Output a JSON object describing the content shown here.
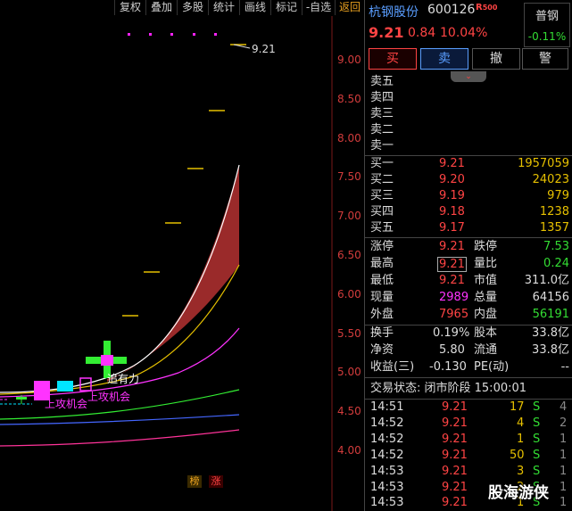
{
  "toolbar": {
    "items": [
      "复权",
      "叠加",
      "多股",
      "统计",
      "画线",
      "标记",
      "-自选",
      "返回"
    ]
  },
  "chart": {
    "y_ticks": [
      "9.00",
      "8.50",
      "8.00",
      "7.50",
      "7.00",
      "6.50",
      "6.00",
      "5.50",
      "5.00",
      "4.50",
      "4.00"
    ],
    "peak_label": "9.21",
    "annotations": [
      "上攻机会",
      "上攻机会",
      "追有力"
    ],
    "bottom_tags": [
      "榜",
      "涨"
    ]
  },
  "stock": {
    "name": "杭钢股份",
    "code": "600126",
    "r_tag": "R",
    "r_num": "500",
    "price": "9.21",
    "change": "0.84",
    "change_pct": "10.04%",
    "index_name": "普钢",
    "index_pct": "-0.11%"
  },
  "actions": [
    "买",
    "卖",
    "撤",
    "警"
  ],
  "asks": [
    {
      "label": "卖五",
      "price": "",
      "vol": ""
    },
    {
      "label": "卖四",
      "price": "",
      "vol": ""
    },
    {
      "label": "卖三",
      "price": "",
      "vol": ""
    },
    {
      "label": "卖二",
      "price": "",
      "vol": ""
    },
    {
      "label": "卖一",
      "price": "",
      "vol": ""
    }
  ],
  "bids": [
    {
      "label": "买一",
      "price": "9.21",
      "vol": "1957059"
    },
    {
      "label": "买二",
      "price": "9.20",
      "vol": "24023"
    },
    {
      "label": "买三",
      "price": "9.19",
      "vol": "979"
    },
    {
      "label": "买四",
      "price": "9.18",
      "vol": "1238"
    },
    {
      "label": "买五",
      "price": "9.17",
      "vol": "1357"
    }
  ],
  "stats": [
    {
      "l1": "涨停",
      "v1": "9.21",
      "l2": "跌停",
      "v2": "7.53"
    },
    {
      "l1": "最高",
      "v1": "9.21",
      "l2": "量比",
      "v2": "0.24"
    },
    {
      "l1": "最低",
      "v1": "9.21",
      "l2": "市值",
      "v2": "311.0亿"
    },
    {
      "l1": "现量",
      "v1": "2989",
      "l2": "总量",
      "v2": "64156"
    },
    {
      "l1": "外盘",
      "v1": "7965",
      "l2": "内盘",
      "v2": "56191"
    }
  ],
  "fin": [
    {
      "l1": "换手",
      "v1": "0.19%",
      "l2": "股本",
      "v2": "33.8亿"
    },
    {
      "l1": "净资",
      "v1": "5.80",
      "l2": "流通",
      "v2": "33.8亿"
    },
    {
      "l1": "收益(三)",
      "v1": "-0.130",
      "l2": "PE(动)",
      "v2": "--"
    }
  ],
  "status": "交易状态: 闭市阶段 15:00:01",
  "ticks": [
    {
      "time": "14:51",
      "price": "9.21",
      "vol": "17",
      "dir": "S",
      "n": "4"
    },
    {
      "time": "14:52",
      "price": "9.21",
      "vol": "4",
      "dir": "S",
      "n": "2"
    },
    {
      "time": "14:52",
      "price": "9.21",
      "vol": "1",
      "dir": "S",
      "n": "1"
    },
    {
      "time": "14:52",
      "price": "9.21",
      "vol": "50",
      "dir": "S",
      "n": "1"
    },
    {
      "time": "14:53",
      "price": "9.21",
      "vol": "3",
      "dir": "S",
      "n": "1"
    },
    {
      "time": "14:53",
      "price": "9.21",
      "vol": "2",
      "dir": "S",
      "n": "1"
    },
    {
      "time": "14:53",
      "price": "9.21",
      "vol": "1",
      "dir": "S",
      "n": "1"
    }
  ],
  "watermark": "股海游侠",
  "colors": {
    "up": "#ff4444",
    "down": "#33dd33",
    "accent": "#e8a020"
  }
}
